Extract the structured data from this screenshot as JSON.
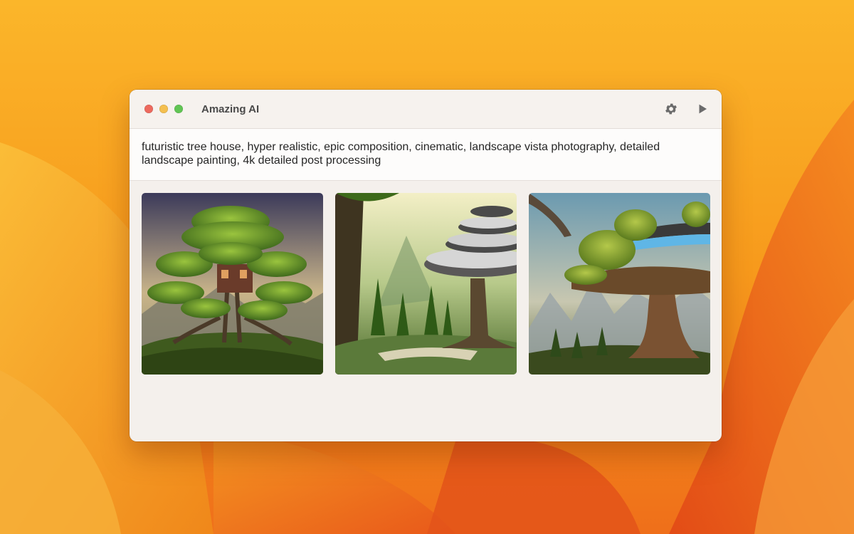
{
  "window": {
    "title": "Amazing AI"
  },
  "toolbar": {
    "settings_icon": "gear-icon",
    "run_icon": "play-icon"
  },
  "prompt": {
    "text": "futuristic tree house, hyper realistic, epic composition, cinematic, landscape vista photography, detailed landscape painting, 4k detailed post processing"
  },
  "gallery": {
    "images": [
      {
        "depicts": "tree-house-image-1"
      },
      {
        "depicts": "tree-house-image-2"
      },
      {
        "depicts": "tree-house-image-3"
      }
    ]
  },
  "colors": {
    "close": "#ed6a5e",
    "minimize": "#f4bf4f",
    "maximize": "#61c554",
    "wallpaper_orange": "#f7a51f"
  }
}
